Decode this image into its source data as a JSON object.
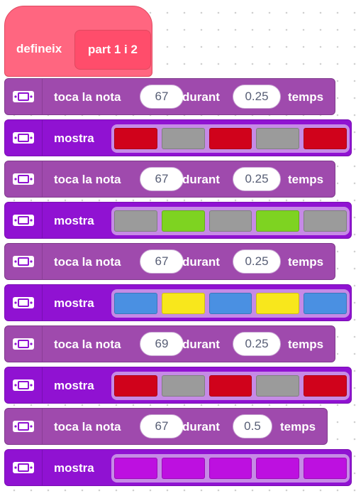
{
  "definition": {
    "label": "defineix",
    "name": "part 1 i 2"
  },
  "labels": {
    "play": "toca la nota",
    "during": "durant",
    "beats": "temps",
    "show": "mostra"
  },
  "blocks": [
    {
      "type": "note",
      "note": "67",
      "beats": "0.25"
    },
    {
      "type": "show",
      "leds": [
        "#d0021b",
        "#9b9b9b",
        "#d0021b",
        "#9b9b9b",
        "#d0021b"
      ]
    },
    {
      "type": "note",
      "note": "67",
      "beats": "0.25"
    },
    {
      "type": "show",
      "leds": [
        "#9b9b9b",
        "#7ed321",
        "#9b9b9b",
        "#7ed321",
        "#9b9b9b"
      ]
    },
    {
      "type": "note",
      "note": "67",
      "beats": "0.25"
    },
    {
      "type": "show",
      "leds": [
        "#4a90e2",
        "#f8e71c",
        "#4a90e2",
        "#f8e71c",
        "#4a90e2"
      ]
    },
    {
      "type": "note",
      "note": "69",
      "beats": "0.25"
    },
    {
      "type": "show",
      "leds": [
        "#d0021b",
        "#9b9b9b",
        "#d0021b",
        "#9b9b9b",
        "#d0021b"
      ]
    },
    {
      "type": "note",
      "note": "67",
      "beats": "0.5"
    },
    {
      "type": "show",
      "leds": [
        "#bd10e0",
        "#bd10e0",
        "#bd10e0",
        "#bd10e0",
        "#bd10e0"
      ]
    }
  ]
}
